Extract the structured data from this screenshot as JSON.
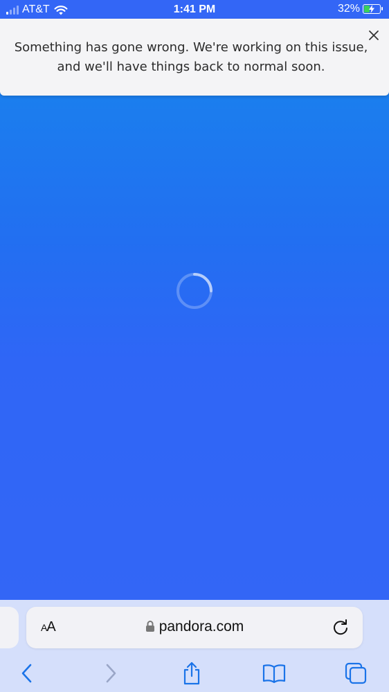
{
  "status_bar": {
    "carrier": "AT&T",
    "time": "1:41 PM",
    "battery_percent": "32%",
    "battery_level": 0.32,
    "signal_bars_filled": 1,
    "charging": true
  },
  "error_banner": {
    "message": "Something has gone wrong. We're working on this issue, and we'll have things back to normal soon.",
    "close_icon": "close-icon"
  },
  "loading": {
    "icon": "spinner-icon"
  },
  "browser": {
    "text_size_label_small": "A",
    "text_size_label_large": "A",
    "url": "pandora.com",
    "lock_icon": "lock-icon",
    "reload_icon": "reload-icon"
  },
  "toolbar": {
    "items": [
      "back-icon",
      "forward-icon",
      "share-icon",
      "bookmarks-icon",
      "tabs-icon"
    ]
  },
  "colors": {
    "page_top": "#1688ec",
    "page_bottom": "#3366f6",
    "banner_bg": "#f4f4f6",
    "toolbar_tint": "#d5dffb",
    "accent": "#1a73e8"
  }
}
